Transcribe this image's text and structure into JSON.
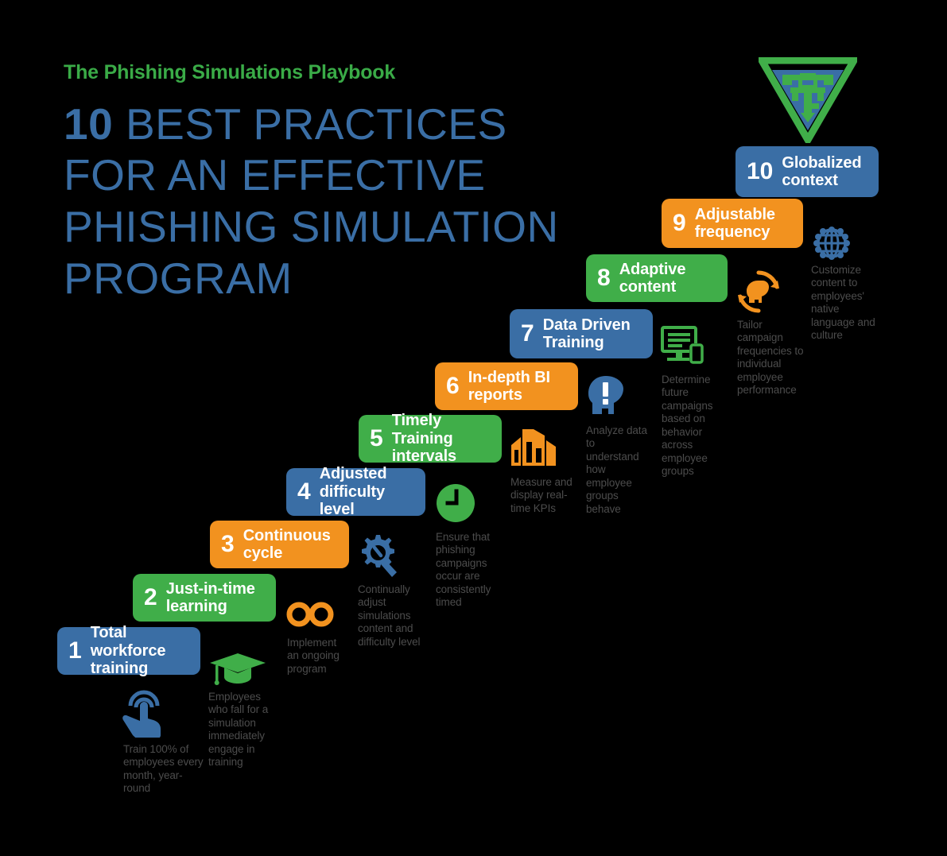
{
  "header": {
    "eyebrow": "The Phishing Simulations Playbook",
    "headline_number": "10",
    "headline_rest": " BEST PRACTICES FOR AN EFFECTIVE PHISHING SIMULATION PROGRAM"
  },
  "colors": {
    "blue": "#3A6EA5",
    "green": "#40AE49",
    "orange": "#F2921F",
    "eyebrow_green": "#3AAB47",
    "caption_gray": "#4c4c4c",
    "background": "#000000"
  },
  "emblem": {
    "name": "superhero-shield",
    "outline_color": "#40AE49",
    "fill_color": "#3A6EA5"
  },
  "steps": [
    {
      "number": "1",
      "title": "Total workforce training",
      "color": "blue",
      "icon": "tap-hand-icon",
      "icon_color": "#3A6EA5",
      "caption": "Train 100% of employees every month, year-round"
    },
    {
      "number": "2",
      "title": "Just-in-time learning",
      "color": "green",
      "icon": "graduation-cap-icon",
      "icon_color": "#40AE49",
      "caption": "Employees who fall for a simulation immediately engage in training"
    },
    {
      "number": "3",
      "title": "Continuous cycle",
      "color": "orange",
      "icon": "infinity-icon",
      "icon_color": "#F2921F",
      "caption": "Implement an ongoing program"
    },
    {
      "number": "4",
      "title": "Adjusted difficulty level",
      "color": "blue",
      "icon": "gear-magnifier-icon",
      "icon_color": "#3A6EA5",
      "caption": "Continually adjust simulations content and difficulty level"
    },
    {
      "number": "5",
      "title": "Timely Training intervals",
      "color": "green",
      "icon": "clock-icon",
      "icon_color": "#40AE49",
      "caption": "Ensure that phishing campaigns occur are consistently timed"
    },
    {
      "number": "6",
      "title": "In-depth BI reports",
      "color": "orange",
      "icon": "bar-chart-3d-icon",
      "icon_color": "#F2921F",
      "caption": "Measure and display real-time KPIs"
    },
    {
      "number": "7",
      "title": "Data Driven Training",
      "color": "blue",
      "icon": "head-exclamation-icon",
      "icon_color": "#3A6EA5",
      "caption": "Analyze data to understand how employee groups behave"
    },
    {
      "number": "8",
      "title": "Adaptive content",
      "color": "green",
      "icon": "monitor-mobile-icon",
      "icon_color": "#40AE49",
      "caption": "Determine future campaigns based on behavior across employee groups"
    },
    {
      "number": "9",
      "title": "Adjustable frequency",
      "color": "orange",
      "icon": "head-refresh-icon",
      "icon_color": "#F2921F",
      "caption": "Tailor campaign frequencies to individual employee performance"
    },
    {
      "number": "10",
      "title": "Globalized context",
      "color": "blue",
      "icon": "globe-icon",
      "icon_color": "#3A6EA5",
      "caption": "Customize content to employees' native language and culture"
    }
  ]
}
